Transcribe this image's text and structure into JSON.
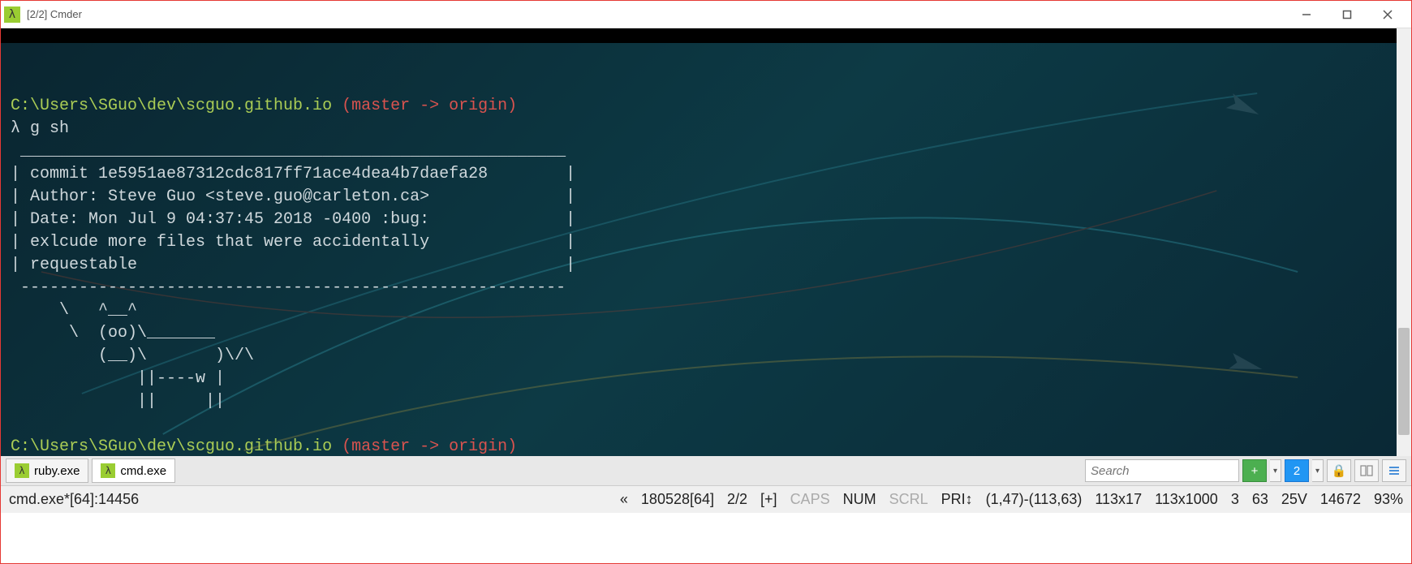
{
  "window": {
    "title": "[2/2] Cmder",
    "icon_char": "λ"
  },
  "terminal": {
    "line1_path": "C:\\Users\\SGuo\\dev\\scguo.github.io",
    "line1_branch": " (master -> origin)",
    "prompt_char": "λ",
    "command": " g sh",
    "output_box_top": " ________________________________________________________",
    "output_lines": [
      "| commit 1e5951ae87312cdc817ff71ace4dea4b7daefa28        |",
      "| Author: Steve Guo <steve.guo@carleton.ca>              |",
      "| Date: Mon Jul 9 04:37:45 2018 -0400 :bug:              |",
      "| exlcude more files that were accidentally              |",
      "| requestable                                            |"
    ],
    "output_box_bottom": " --------------------------------------------------------",
    "cow_lines": [
      "     \\   ^__^",
      "      \\  (oo)\\_______",
      "         (__)\\       )\\/\\",
      "             ||----w |",
      "             ||     ||"
    ],
    "line2_path": "C:\\Users\\SGuo\\dev\\scguo.github.io",
    "line2_branch": " (master -> origin)"
  },
  "tabs": [
    {
      "label": "ruby.exe",
      "active": false
    },
    {
      "label": "cmd.exe",
      "active": true
    }
  ],
  "search": {
    "placeholder": "Search"
  },
  "toolbar": {
    "plus": "+",
    "num": "2",
    "lock": "🔒"
  },
  "status": {
    "active_process": "cmd.exe*[64]:14456",
    "chevrons": "«",
    "date_seg": "180528[64]",
    "tab_index": "2/2",
    "plus": "[+]",
    "caps": "CAPS",
    "num": "NUM",
    "scrl": "SCRL",
    "pri": "PRI↕",
    "selection": "(1,47)-(113,63)",
    "size1": "113x17",
    "size2": "113x1000",
    "n1": "3",
    "n2": "63",
    "n3": "25V",
    "n4": "14672",
    "pct": "93%"
  }
}
